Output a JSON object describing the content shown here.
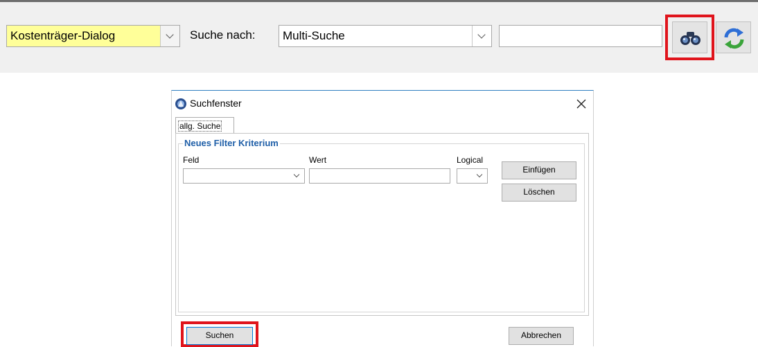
{
  "toolbar": {
    "dialog_select": {
      "value": "Kostenträger-Dialog"
    },
    "search_label": "Suche nach:",
    "search_mode_select": {
      "value": "Multi-Suche"
    },
    "search_input": {
      "value": ""
    }
  },
  "search_dialog": {
    "title": "Suchfenster",
    "tabs": [
      {
        "label": "allg. Suche"
      }
    ],
    "filter_group": {
      "title": "Neues Filter Kriterium",
      "column_labels": {
        "field": "Feld",
        "value": "Wert",
        "logical": "Logical"
      },
      "insert_button": "Einfügen",
      "delete_button": "Löschen"
    },
    "search_button": "Suchen",
    "cancel_button": "Abbrechen"
  },
  "colors": {
    "highlight": "#e0141c",
    "accent": "#2f7fc1",
    "group_title": "#1f5fa8",
    "dialog_select_bg": "#ffff99"
  },
  "icons": {
    "search": "binoculars-icon",
    "refresh": "refresh-icon",
    "app": "app-logo-icon",
    "close": "close-icon"
  }
}
